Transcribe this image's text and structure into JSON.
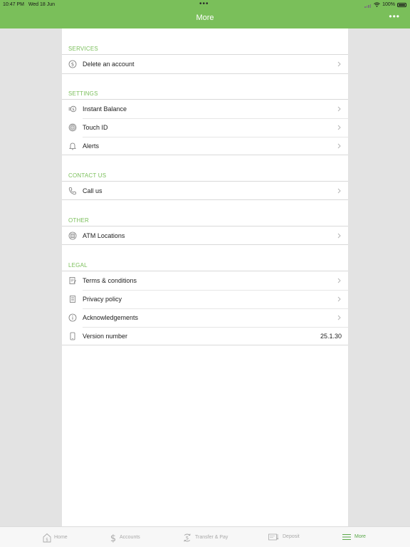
{
  "status_bar": {
    "time": "10:47 PM",
    "date": "Wed 18 Jun",
    "battery": "100%"
  },
  "header": {
    "title": "More",
    "menu_dots": "•••",
    "top_dots": "•••"
  },
  "colors": {
    "accent": "#7abf5a",
    "tab_active": "#5aa84a",
    "panel": "#ffffff",
    "background": "#e3e3e3"
  },
  "sections": {
    "services": {
      "title": "SERVICES",
      "items": [
        {
          "label": "Delete an account",
          "icon": "dollar-circle-icon"
        }
      ]
    },
    "settings": {
      "title": "SETTINGS",
      "items": [
        {
          "label": "Instant Balance",
          "icon": "instant-balance-icon"
        },
        {
          "label": "Touch ID",
          "icon": "fingerprint-icon"
        },
        {
          "label": "Alerts",
          "icon": "bell-icon"
        }
      ]
    },
    "contact": {
      "title": "CONTACT US",
      "items": [
        {
          "label": "Call us",
          "icon": "phone-icon"
        }
      ]
    },
    "other": {
      "title": "OTHER",
      "items": [
        {
          "label": "ATM Locations",
          "icon": "atm-icon"
        }
      ]
    },
    "legal": {
      "title": "LEGAL",
      "items": [
        {
          "label": "Terms & conditions",
          "icon": "document-pen-icon"
        },
        {
          "label": "Privacy policy",
          "icon": "document-icon"
        },
        {
          "label": "Acknowledgements",
          "icon": "info-icon"
        },
        {
          "label": "Version number",
          "icon": "device-icon",
          "value": "25.1.30"
        }
      ]
    }
  },
  "tabbar": {
    "items": [
      {
        "label": "Home",
        "icon": "home-icon"
      },
      {
        "label": "Accounts",
        "icon": "dollar-icon"
      },
      {
        "label": "Transfer & Pay",
        "icon": "transfer-icon"
      },
      {
        "label": "Deposit",
        "icon": "deposit-icon"
      },
      {
        "label": "More",
        "icon": "menu-icon",
        "active": true
      }
    ]
  }
}
